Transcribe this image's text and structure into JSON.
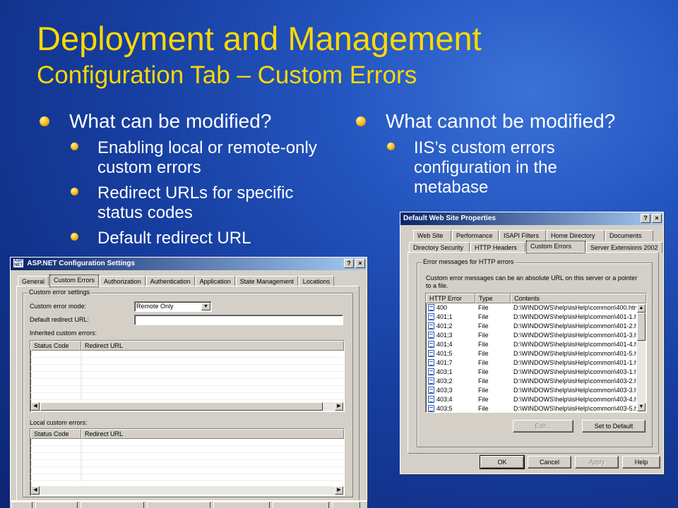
{
  "slide": {
    "title": "Deployment and Management",
    "subtitle": "Configuration Tab – Custom Errors",
    "left": {
      "heading": "What can be modified?",
      "items": [
        "Enabling local or remote-only custom errors",
        "Redirect URLs for specific status codes",
        "Default redirect URL"
      ]
    },
    "right": {
      "heading": "What cannot be modified?",
      "items": [
        "IIS’s custom errors configuration in the metabase"
      ]
    }
  },
  "aspnet": {
    "title": "ASP.NET Configuration Settings",
    "tabs": [
      "General",
      "Custom Errors",
      "Authorization",
      "Authentication",
      "Application",
      "State Management",
      "Locations"
    ],
    "group": "Custom error settings",
    "mode_label": "Custom error mode:",
    "mode_value": "Remote Only",
    "default_url_label": "Default redirect URL:",
    "default_url_value": "",
    "inherited_label": "Inherited custom errors:",
    "local_label": "Local custom errors:",
    "columns": [
      "Status Code",
      "Redirect URL"
    ]
  },
  "iis": {
    "title": "Default Web Site Properties",
    "tabs_row1": [
      "Web Site",
      "Performance",
      "ISAPI Filters",
      "Home Directory",
      "Documents"
    ],
    "tabs_row2": [
      "Directory Security",
      "HTTP Headers",
      "Custom Errors",
      "Server Extensions 2002"
    ],
    "group": "Error messages for HTTP errors",
    "description": "Custom error messages can be an absolute URL on this server or a pointer to a file.",
    "columns": [
      "HTTP Error",
      "Type",
      "Contents"
    ],
    "rows": [
      {
        "code": "400",
        "type": "File",
        "contents": "D:\\WINDOWS\\help\\iisHelp\\common\\400.htm"
      },
      {
        "code": "401;1",
        "type": "File",
        "contents": "D:\\WINDOWS\\help\\iisHelp\\common\\401-1.h"
      },
      {
        "code": "401;2",
        "type": "File",
        "contents": "D:\\WINDOWS\\help\\iisHelp\\common\\401-2.h"
      },
      {
        "code": "401;3",
        "type": "File",
        "contents": "D:\\WINDOWS\\help\\iisHelp\\common\\401-3.h"
      },
      {
        "code": "401;4",
        "type": "File",
        "contents": "D:\\WINDOWS\\help\\iisHelp\\common\\401-4.h"
      },
      {
        "code": "401;5",
        "type": "File",
        "contents": "D:\\WINDOWS\\help\\iisHelp\\common\\401-5.h"
      },
      {
        "code": "401;7",
        "type": "File",
        "contents": "D:\\WINDOWS\\help\\iisHelp\\common\\401-1.h"
      },
      {
        "code": "403;1",
        "type": "File",
        "contents": "D:\\WINDOWS\\help\\iisHelp\\common\\403-1.h"
      },
      {
        "code": "403;2",
        "type": "File",
        "contents": "D:\\WINDOWS\\help\\iisHelp\\common\\403-2.h"
      },
      {
        "code": "403;3",
        "type": "File",
        "contents": "D:\\WINDOWS\\help\\iisHelp\\common\\403-3.h"
      },
      {
        "code": "403;4",
        "type": "File",
        "contents": "D:\\WINDOWS\\help\\iisHelp\\common\\403-4.h"
      },
      {
        "code": "403;5",
        "type": "File",
        "contents": "D:\\WINDOWS\\help\\iisHelp\\common\\403-5.h"
      }
    ],
    "edit_label": "Edit...",
    "set_default_label": "Set to Default",
    "ok_label": "OK",
    "cancel_label": "Cancel",
    "apply_label": "Apply",
    "help_label": "Help"
  },
  "colors": {
    "title": "#ffd800",
    "bullet": "#ffc21a",
    "window_bg": "#d4d0c8",
    "titlebar": "#0a246a"
  }
}
